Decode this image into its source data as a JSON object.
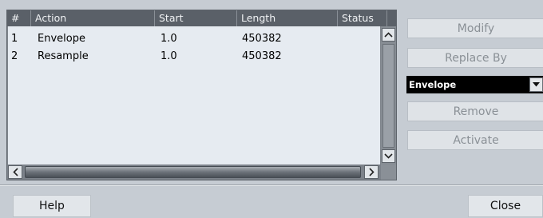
{
  "table": {
    "columns": [
      "#",
      "Action",
      "Start",
      "Length",
      "Status"
    ],
    "rows": [
      {
        "num": "1",
        "action": "Envelope",
        "start": "1.0",
        "length": "450382",
        "status": ""
      },
      {
        "num": "2",
        "action": "Resample",
        "start": "1.0",
        "length": "450382",
        "status": ""
      }
    ]
  },
  "side": {
    "modify_label": "Modify",
    "replace_by_label": "Replace By",
    "dropdown_value": "Envelope",
    "remove_label": "Remove",
    "activate_label": "Activate"
  },
  "footer": {
    "help_label": "Help",
    "close_label": "Close"
  },
  "icons": {
    "scroll_up": "chevron-up-icon",
    "scroll_down": "chevron-down-icon",
    "scroll_left": "chevron-left-icon",
    "scroll_right": "chevron-right-icon",
    "dropdown": "caret-down-icon"
  }
}
